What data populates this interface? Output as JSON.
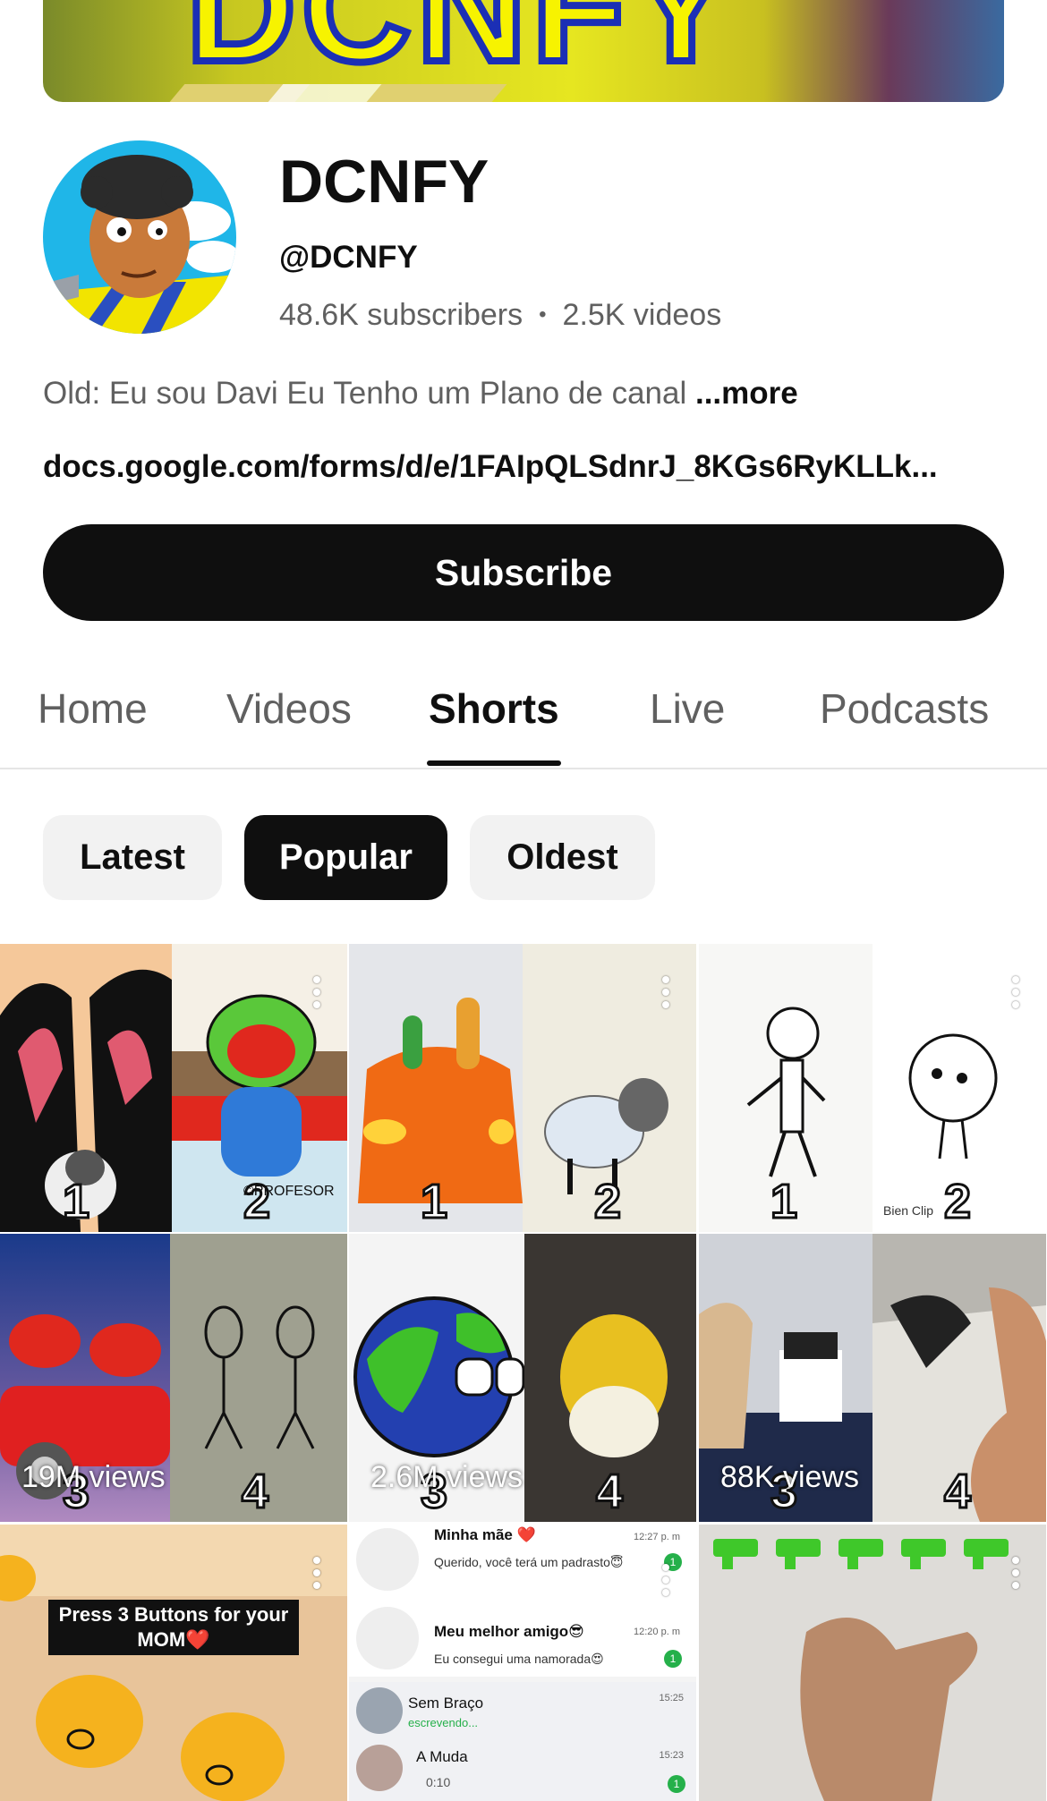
{
  "channel": {
    "name": "DCNFY",
    "handle": "@DCNFY",
    "subscribers": "48.6K subscribers",
    "separator": "•",
    "videos": "2.5K videos",
    "description": "Old: Eu sou Davi Eu Tenho um Plano de canal",
    "more_label": "...more",
    "link": "docs.google.com/forms/d/e/1FAIpQLSdnrJ_8KGs6RyKLLk...",
    "banner_text": "DCNFY"
  },
  "subscribe_label": "Subscribe",
  "tabs": [
    {
      "label": "Home",
      "active": false
    },
    {
      "label": "Videos",
      "active": false
    },
    {
      "label": "Shorts",
      "active": true
    },
    {
      "label": "Live",
      "active": false
    },
    {
      "label": "Podcasts",
      "active": false
    }
  ],
  "sort_chips": [
    {
      "label": "Latest",
      "active": false
    },
    {
      "label": "Popular",
      "active": true
    },
    {
      "label": "Oldest",
      "active": false
    }
  ],
  "shorts": [
    {
      "row": 1,
      "numbers": [
        "1",
        "2"
      ],
      "views": "",
      "thumb_caption": "©PROFESOR"
    },
    {
      "row": 1,
      "numbers": [
        "1",
        "2"
      ],
      "views": ""
    },
    {
      "row": 1,
      "numbers": [
        "1",
        "2"
      ],
      "views": "",
      "thumb_caption": "Bien Clip"
    },
    {
      "row": 2,
      "numbers": [
        "3",
        "4"
      ],
      "views": "19M views"
    },
    {
      "row": 2,
      "numbers": [
        "3",
        "4"
      ],
      "views": "2.6M views"
    },
    {
      "row": 2,
      "numbers": [
        "3",
        "4"
      ],
      "views": "88K views"
    },
    {
      "row": 3,
      "caption": "Press 3 Buttons for your MOM❤️"
    },
    {
      "row": 3,
      "chats": [
        {
          "name": "Minha mãe ❤️",
          "msg": "Querido, você terá um padrasto😇",
          "time": "12:27 p. m",
          "badge": "1"
        },
        {
          "name": "Meu melhor amigo😎",
          "msg": "Eu consegui uma namorada😍",
          "time": "12:20 p. m",
          "badge": "1"
        },
        {
          "name": "Sem Braço",
          "msg": "escrevendo...",
          "time": "15:25"
        },
        {
          "name": "A Muda",
          "msg": "0:10",
          "time": "15:23",
          "badge": "1"
        }
      ]
    },
    {
      "row": 3,
      "caption": ""
    }
  ],
  "colors": {
    "accent": "#0f0f0f",
    "muted": "#606060",
    "chip_bg": "#f2f2f2"
  }
}
